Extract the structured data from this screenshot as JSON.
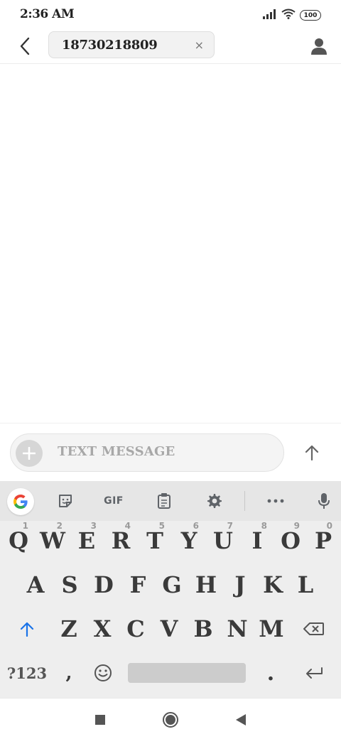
{
  "status_bar": {
    "time": "2:36 AM",
    "battery": "100",
    "icons": [
      "signal-icon",
      "wifi-icon",
      "battery-icon"
    ]
  },
  "header": {
    "back_icon": "chevron-left-icon",
    "recipient": "18730218809",
    "remove_icon": "close-icon",
    "remove_glyph": "×",
    "contact_icon": "person-icon"
  },
  "compose": {
    "placeholder": "TEXT MESSAGE",
    "add_icon": "plus-icon",
    "send_icon": "arrow-up-icon"
  },
  "keyboard": {
    "toolbar": {
      "items": [
        "google-icon",
        "sticker-icon",
        "gif",
        "clipboard-icon",
        "gear-icon",
        "more-icon",
        "mic-icon"
      ],
      "gif_label": "GIF"
    },
    "row1": [
      {
        "key": "Q",
        "hint": "1"
      },
      {
        "key": "W",
        "hint": "2"
      },
      {
        "key": "E",
        "hint": "3"
      },
      {
        "key": "R",
        "hint": "4"
      },
      {
        "key": "T",
        "hint": "5"
      },
      {
        "key": "Y",
        "hint": "6"
      },
      {
        "key": "U",
        "hint": "7"
      },
      {
        "key": "I",
        "hint": "8"
      },
      {
        "key": "O",
        "hint": "9"
      },
      {
        "key": "P",
        "hint": "0"
      }
    ],
    "row2": [
      "A",
      "S",
      "D",
      "F",
      "G",
      "H",
      "J",
      "K",
      "L"
    ],
    "row3": [
      "Z",
      "X",
      "C",
      "V",
      "B",
      "N",
      "M"
    ],
    "row4": {
      "symbols": "?123",
      "comma": ",",
      "period": ".",
      "enter_icon": "enter-icon",
      "emoji_icon": "emoji-icon"
    },
    "shift_icon": "shift-icon",
    "backspace_icon": "backspace-icon",
    "accent_color": "#1a73e8"
  },
  "nav_bar": {
    "items": [
      "recents-square-icon",
      "home-circle-icon",
      "back-triangle-icon"
    ]
  }
}
